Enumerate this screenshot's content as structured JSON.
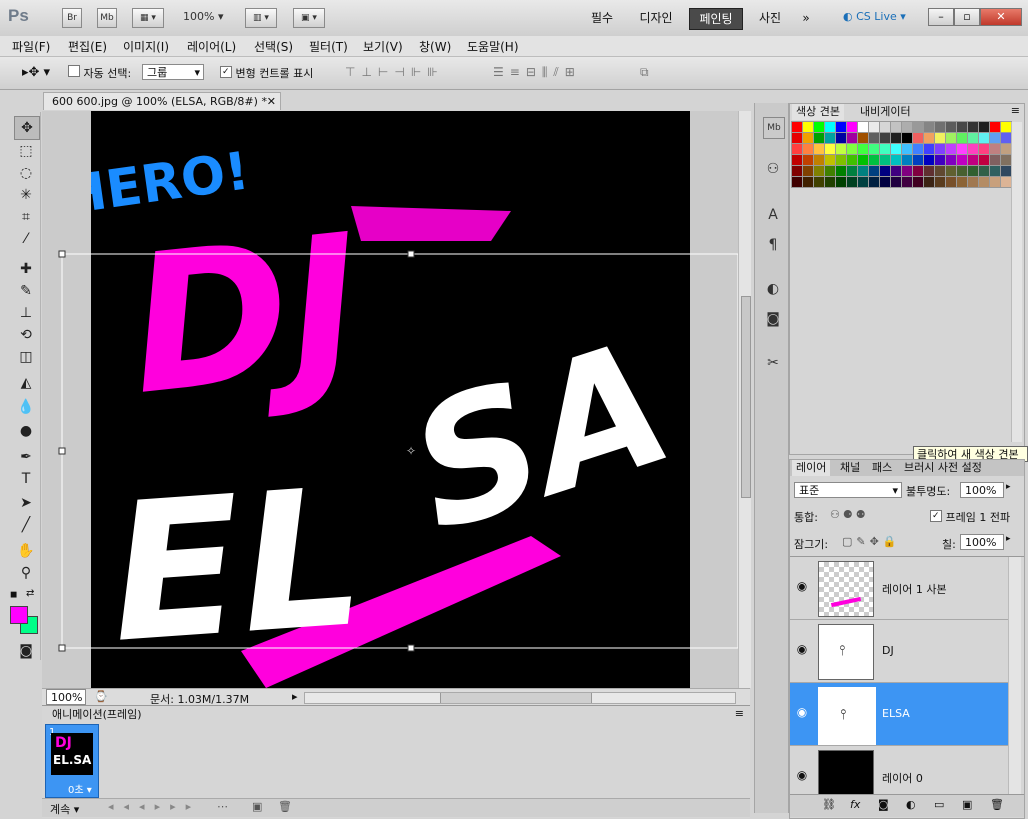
{
  "app": {
    "logo": "Ps",
    "bridge": "Br",
    "minibridge": "Mb",
    "zoom": "100%",
    "workspaces": [
      "필수",
      "디자인",
      "페인팅",
      "사진"
    ],
    "active_workspace": "페인팅",
    "more": "»",
    "cs_live": "CS Live",
    "window_controls": [
      "–",
      "▫",
      "✕"
    ]
  },
  "menu": [
    "파일(F)",
    "편집(E)",
    "이미지(I)",
    "레이어(L)",
    "선택(S)",
    "필터(T)",
    "보기(V)",
    "창(W)",
    "도움말(H)"
  ],
  "options": {
    "auto_select_label": "자동 선택:",
    "auto_select_value": "그룹",
    "transform_label": "변형 컨트롤 표시"
  },
  "document": {
    "tab_title": "600 600.jpg @ 100% (ELSA, RGB/8#) *",
    "status_zoom": "100%",
    "status_doc": "문서: 1.03M/1.37M"
  },
  "artwork": {
    "hero": "HERO!",
    "dj": "DJ",
    "elsa_1": "EL",
    "elsa_2": "SA"
  },
  "animation": {
    "panel_title": "애니메이션(프레임)",
    "frame_number": "1",
    "frame_delay": "0초",
    "loop": "계속",
    "thumb_text_dj": "DJ",
    "thumb_text_elsa": "EL.SA"
  },
  "swatches": {
    "tabs": [
      "색상 견본",
      "내비게이터"
    ],
    "colors": [
      [
        "#ff0000",
        "#ffff00",
        "#00ff00",
        "#00ffff",
        "#0000ff",
        "#ff00ff",
        "#ffffff",
        "#ebebeb",
        "#d6d6d6",
        "#c2c2c2",
        "#adadad",
        "#999999",
        "#858585",
        "#707070",
        "#5c5c5c",
        "#474747",
        "#333333",
        "#1f1f1f",
        "#ff0000",
        "#ffff00"
      ],
      [
        "#e60000",
        "#f0a000",
        "#00a000",
        "#00a0a0",
        "#0000a0",
        "#a000a0",
        "#a05000",
        "#606060",
        "#404040",
        "#202020",
        "#000000",
        "#f06060",
        "#f0a060",
        "#f0f060",
        "#a0f060",
        "#60f060",
        "#60f0a0",
        "#60f0f0",
        "#60a0f0",
        "#6060f0"
      ],
      [
        "#ff4040",
        "#ff8040",
        "#ffc040",
        "#ffff40",
        "#c0ff40",
        "#80ff40",
        "#40ff40",
        "#40ff80",
        "#40ffc0",
        "#40ffff",
        "#40c0ff",
        "#4080ff",
        "#4040ff",
        "#8040ff",
        "#c040ff",
        "#ff40ff",
        "#ff40c0",
        "#ff4080",
        "#c08080",
        "#c0a080"
      ],
      [
        "#c00000",
        "#c04000",
        "#c08000",
        "#c0c000",
        "#80c000",
        "#40c000",
        "#00c000",
        "#00c040",
        "#00c080",
        "#00c0c0",
        "#0080c0",
        "#0040c0",
        "#0000c0",
        "#4000c0",
        "#8000c0",
        "#c000c0",
        "#c00080",
        "#c00040",
        "#806060",
        "#807060"
      ],
      [
        "#800000",
        "#804000",
        "#808000",
        "#408000",
        "#008000",
        "#008040",
        "#008080",
        "#004080",
        "#000080",
        "#400080",
        "#800080",
        "#800040",
        "#603030",
        "#604830",
        "#606030",
        "#486030",
        "#306030",
        "#306048",
        "#306060",
        "#304860"
      ],
      [
        "#400000",
        "#402000",
        "#404000",
        "#204000",
        "#004000",
        "#004020",
        "#004040",
        "#002040",
        "#000040",
        "#200040",
        "#400040",
        "#400020",
        "#3c2414",
        "#5a3c1e",
        "#78502a",
        "#8c6436",
        "#a07850",
        "#b48c64",
        "#c8a07c",
        "#dcb496"
      ]
    ]
  },
  "layers": {
    "tabs": [
      "레이어",
      "채널",
      "패스",
      "브러시 사전 설정"
    ],
    "blend_mode": "표준",
    "opacity_label": "불투명도:",
    "opacity": "100%",
    "unify_label": "통합:",
    "propagate_label": "프레임 1 전파",
    "lock_label": "잠그기:",
    "fill_label": "칠:",
    "fill": "100%",
    "items": [
      {
        "name": "레이어 1 사본",
        "selected": false
      },
      {
        "name": "DJ",
        "selected": false
      },
      {
        "name": "ELSA",
        "selected": true
      },
      {
        "name": "레이어 0",
        "selected": false
      }
    ],
    "footer_icons": [
      "link-icon",
      "fx-icon",
      "mask-icon",
      "adjustment-icon",
      "group-icon",
      "new-layer-icon",
      "trash-icon"
    ]
  },
  "tooltip": "클릭하여 새 색상 견본",
  "colors": {
    "foreground": "#ff00ff",
    "background": "#00ff88",
    "selection": "#3d95f3",
    "magenta": "#ff00dd",
    "hero_blue": "#1a8cff"
  }
}
